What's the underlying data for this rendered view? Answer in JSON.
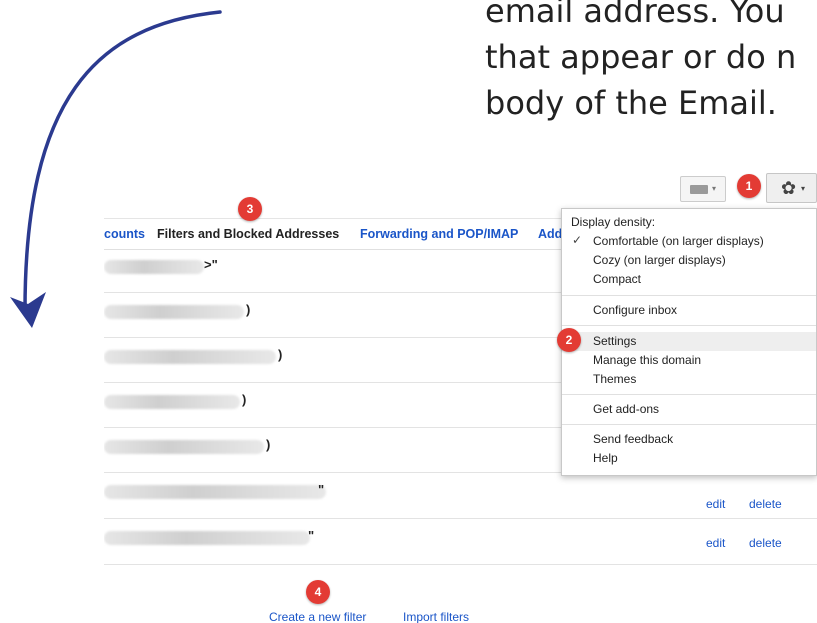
{
  "caption": {
    "lines": [
      "email address. You",
      "that appear or do n",
      "body of the Email."
    ]
  },
  "toolbar": {
    "keyboard_icon": "keyboard-icon",
    "settings_icon": "gear-icon",
    "settings_glyph": "✿"
  },
  "tabs": [
    {
      "label": "counts",
      "active": false
    },
    {
      "label": "Filters and Blocked Addresses",
      "active": true
    },
    {
      "label": "Forwarding and POP/IMAP",
      "active": false
    },
    {
      "label": "Add",
      "active": false
    }
  ],
  "filters": {
    "rows": [
      {
        "end_text": ">\"",
        "actions": []
      },
      {
        "end_text": ")",
        "actions": []
      },
      {
        "end_text": ")",
        "actions": []
      },
      {
        "end_text": ")",
        "actions": []
      },
      {
        "end_text": ")",
        "actions": []
      },
      {
        "end_text": "\"",
        "actions": [
          "edit",
          "delete"
        ]
      },
      {
        "end_text": "\"",
        "actions": [
          "edit",
          "delete"
        ]
      }
    ],
    "create_link": "Create a new filter",
    "import_link": "Import filters"
  },
  "settings_menu": {
    "display_density_label": "Display density:",
    "checkmark": "✓",
    "density_options": [
      {
        "label": "Comfortable (on larger displays)",
        "selected": true
      },
      {
        "label": "Cozy (on larger displays)",
        "selected": false
      },
      {
        "label": "Compact",
        "selected": false
      }
    ],
    "configure_inbox": "Configure inbox",
    "settings": "Settings",
    "manage_domain": "Manage this domain",
    "themes": "Themes",
    "get_addons": "Get add-ons",
    "send_feedback": "Send feedback",
    "help": "Help"
  },
  "step_badges": [
    "1",
    "2",
    "3",
    "4"
  ],
  "colors": {
    "link_blue": "#1a55c8",
    "badge_red": "#e33b34",
    "arrow_navy": "#2b3a8f"
  }
}
